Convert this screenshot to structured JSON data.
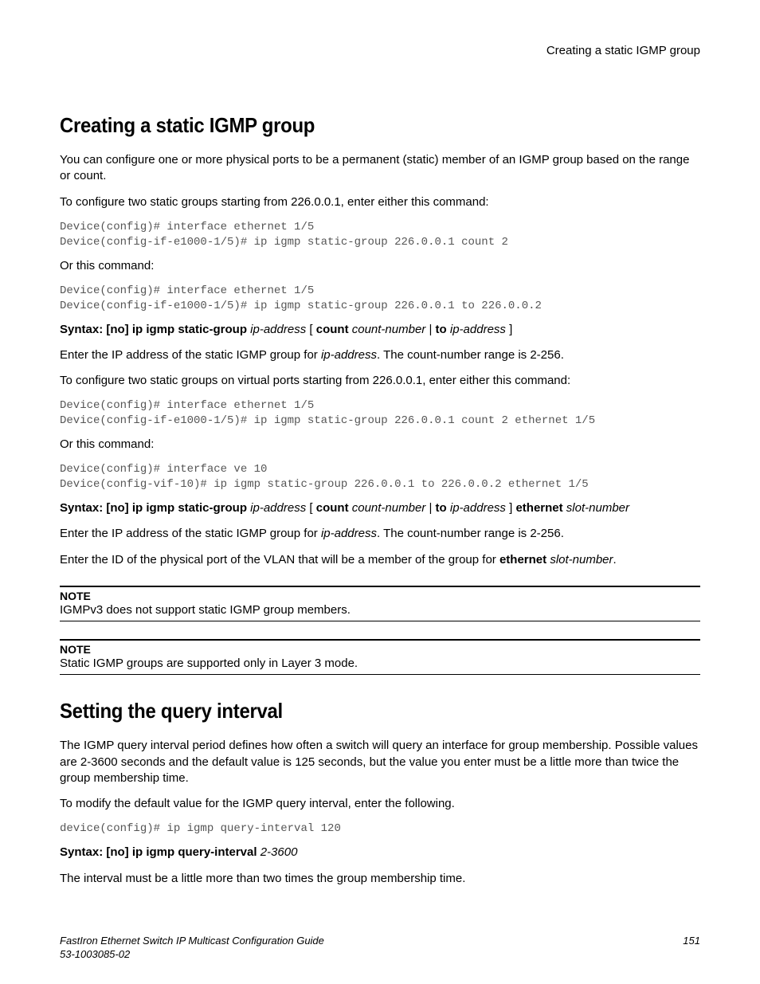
{
  "header": {
    "right": "Creating a static IGMP group"
  },
  "section1": {
    "title": "Creating a static IGMP group",
    "intro1": "You can configure one or more physical ports to be a permanent (static) member of an IGMP group based on the range or count.",
    "intro2": "To configure two static groups starting from 226.0.0.1, enter either this command:",
    "code1": "Device(config)# interface ethernet 1/5\nDevice(config-if-e1000-1/5)# ip igmp static-group 226.0.0.1 count 2",
    "or1": "Or this command:",
    "code2": "Device(config)# interface ethernet 1/5\nDevice(config-if-e1000-1/5)# ip igmp static-group 226.0.0.1 to 226.0.0.2",
    "syntax1": {
      "pre": "Syntax: [no] ip igmp static-group",
      "arg1": "ip-address",
      "mid1": " [ ",
      "b2": "count",
      "arg2": "count-number",
      "mid2": " | ",
      "b3": "to",
      "arg3": "ip-address",
      "end": " ]"
    },
    "desc1a": "Enter the IP address of the static IGMP group for ",
    "desc1b": "ip-address",
    "desc1c": ". The count-number range is 2-256.",
    "desc2": "To configure two static groups on virtual ports starting from 226.0.0.1, enter either this command:",
    "code3": "Device(config)# interface ethernet 1/5\nDevice(config-if-e1000-1/5)# ip igmp static-group 226.0.0.1 count 2 ethernet 1/5",
    "or2": "Or this command:",
    "code4": "Device(config)# interface ve 10\nDevice(config-vif-10)# ip igmp static-group 226.0.0.1 to 226.0.0.2 ethernet 1/5",
    "syntax2": {
      "pre": "Syntax: [no] ip igmp static-group",
      "arg1": "ip-address",
      "mid1": " [ ",
      "b2": "count",
      "arg2": "count-number",
      "mid2": " | ",
      "b3": "to",
      "arg3": "ip-address",
      "mid3": " ] ",
      "b4": "ethernet",
      "arg4": "slot-number"
    },
    "desc3a": "Enter the IP address of the static IGMP group for ",
    "desc3b": "ip-address",
    "desc3c": ". The count-number range is 2-256.",
    "desc4a": "Enter the ID of the physical port of the VLAN that will be a member of the group for ",
    "desc4b": "ethernet",
    "desc4c": "slot-number",
    "desc4d": ".",
    "note1_label": "NOTE",
    "note1_text": "IGMPv3 does not support static IGMP group members.",
    "note2_label": "NOTE",
    "note2_text": "Static IGMP groups are supported only in Layer 3 mode."
  },
  "section2": {
    "title": "Setting the query interval",
    "p1": "The IGMP query interval period defines how often a switch will query an interface for group membership. Possible values are 2-3600 seconds and the default value is 125 seconds, but the value you enter must be a little more than twice the group membership time.",
    "p2": "To modify the default value for the IGMP query interval, enter the following.",
    "code1": "device(config)# ip igmp query-interval 120",
    "syntax": {
      "pre": "Syntax: [no] ip igmp query-interval",
      "arg": "2-3600"
    },
    "p3": "The interval must be a little more than two times the group membership time."
  },
  "footer": {
    "l1": "FastIron Ethernet Switch IP Multicast Configuration Guide",
    "l2": "53-1003085-02",
    "pg": "151"
  }
}
